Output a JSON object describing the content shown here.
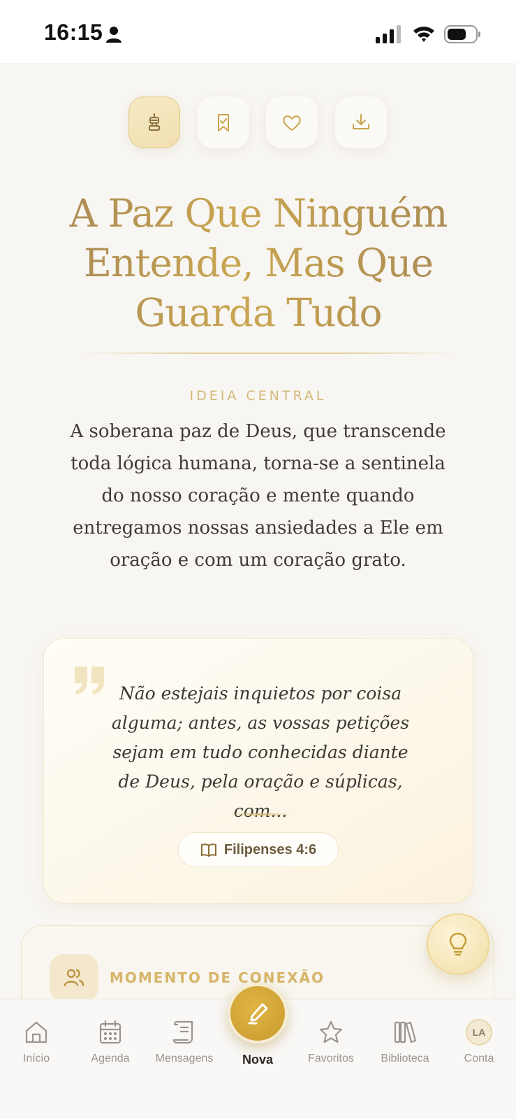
{
  "status_bar": {
    "time": "16:15"
  },
  "actions": {
    "items": [
      {
        "icon": "lamp-icon",
        "active": true
      },
      {
        "icon": "bookmark-check-icon",
        "active": false
      },
      {
        "icon": "heart-icon",
        "active": false
      },
      {
        "icon": "download-icon",
        "active": false
      }
    ]
  },
  "sermon": {
    "title": "A Paz Que Ninguém Entende, Mas Que Guarda Tudo",
    "central_label": "IDEIA CENTRAL",
    "central_text": "A soberana paz de Deus, que transcende toda lógica humana, torna-se a sentinela do nosso coração e mente quando entregamos nossas ansiedades a Ele em oração e com um coração grato."
  },
  "quote": {
    "text": "Não estejais inquietos por coisa alguma; antes, as vossas petições sejam em tudo conhecidas diante de Deus, pela oração e súplicas, com...",
    "reference": "Filipenses 4:6"
  },
  "connection": {
    "label": "MOMENTO DE CONEXÃO"
  },
  "tabs": {
    "inicio": "Início",
    "agenda": "Agenda",
    "mensagens": "Mensagens",
    "nova": "Nova",
    "favoritos": "Favoritos",
    "biblioteca": "Biblioteca",
    "conta": "Conta",
    "avatar_initials": "LA"
  },
  "colors": {
    "accent_gold": "#c99a2e",
    "background": "#f8f6f2",
    "tab_active": "#2d2a26",
    "tab_inactive": "#9a9590"
  }
}
